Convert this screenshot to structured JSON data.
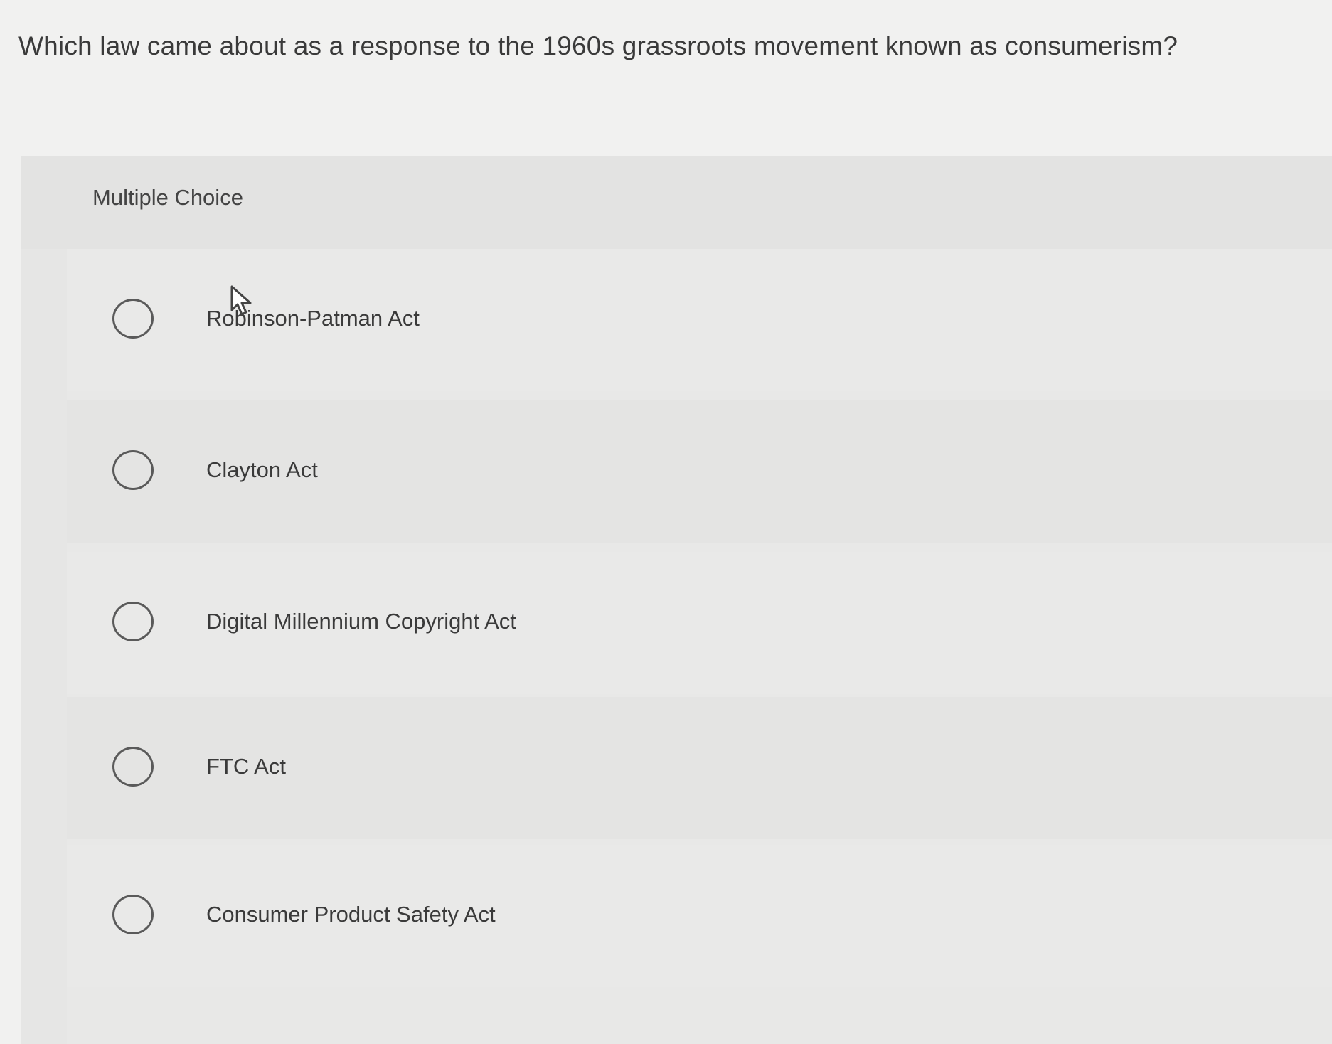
{
  "question": {
    "text": "Which law came about as a response to the 1960s grassroots movement known as consumerism?"
  },
  "multiple_choice": {
    "label": "Multiple Choice",
    "options": [
      {
        "label": "Robinson-Patman Act",
        "selected": false
      },
      {
        "label": "Clayton Act",
        "selected": false
      },
      {
        "label": "Digital Millennium Copyright Act",
        "selected": false
      },
      {
        "label": "FTC Act",
        "selected": false
      },
      {
        "label": "Consumer Product Safety Act",
        "selected": false
      }
    ]
  },
  "icons": {
    "cursor": "mouse-pointer-icon",
    "radio": "radio-button-icon"
  },
  "colors": {
    "background": "#f1f1f0",
    "panel": "#e6e6e5",
    "text": "#3a3a3a",
    "radio_border": "#5a5a5a"
  }
}
